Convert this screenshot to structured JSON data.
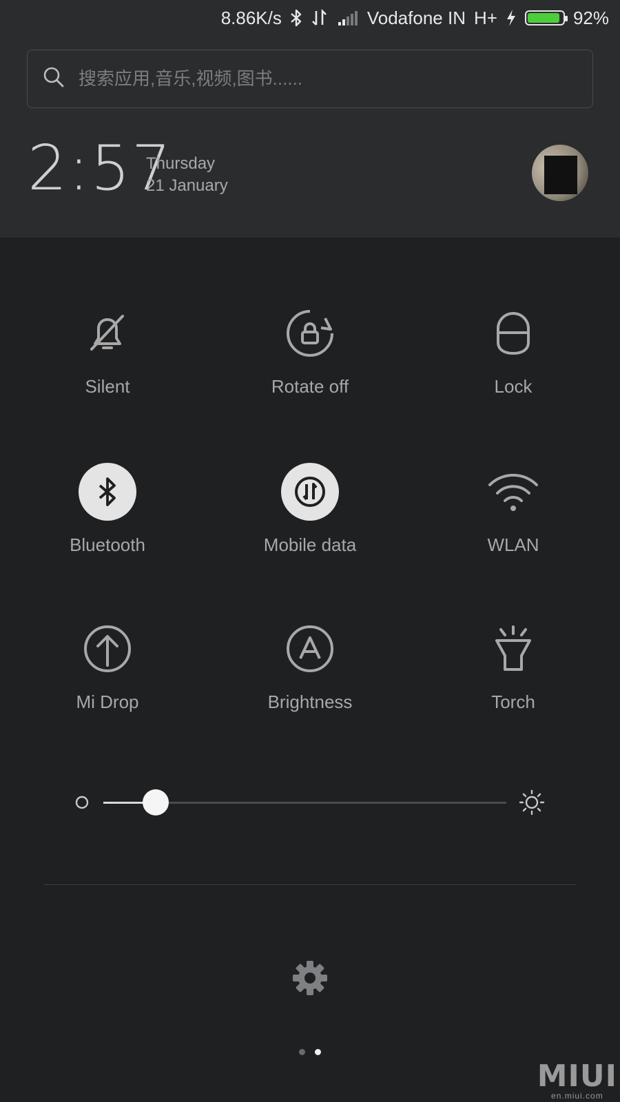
{
  "status_bar": {
    "net_speed": "8.86K/s",
    "carrier": "Vodafone IN",
    "network_type": "H+",
    "battery_percent": "92%",
    "battery_level": 0.92,
    "icons": [
      "bluetooth-icon",
      "data-transfer-icon",
      "signal-icon",
      "charging-icon",
      "battery-icon"
    ]
  },
  "search": {
    "placeholder": "搜索应用,音乐,视频,图书......"
  },
  "clock": {
    "time": "2:57",
    "day": "Thursday",
    "date": "21 January"
  },
  "toggles": [
    {
      "label": "Silent",
      "icon": "bell-off-icon",
      "active": false
    },
    {
      "label": "Rotate off",
      "icon": "rotate-lock-icon",
      "active": false
    },
    {
      "label": "Lock",
      "icon": "lock-icon",
      "active": false
    },
    {
      "label": "Bluetooth",
      "icon": "bluetooth-icon",
      "active": true
    },
    {
      "label": "Mobile data",
      "icon": "mobile-data-icon",
      "active": true
    },
    {
      "label": "WLAN",
      "icon": "wifi-icon",
      "active": false
    },
    {
      "label": "Mi Drop",
      "icon": "upload-arrow-icon",
      "active": false
    },
    {
      "label": "Brightness",
      "icon": "auto-brightness-icon",
      "active": false
    },
    {
      "label": "Torch",
      "icon": "torch-icon",
      "active": false
    }
  ],
  "brightness": {
    "level": 0.13
  },
  "pager": {
    "pages": 2,
    "current": 2
  },
  "watermark": {
    "brand": "MIUI",
    "site": "en.miui.com"
  },
  "colors": {
    "background": "#1f2022",
    "header": "#2b2c2e",
    "battery": "#4ccd3c",
    "active_toggle": "#e4e4e4"
  }
}
